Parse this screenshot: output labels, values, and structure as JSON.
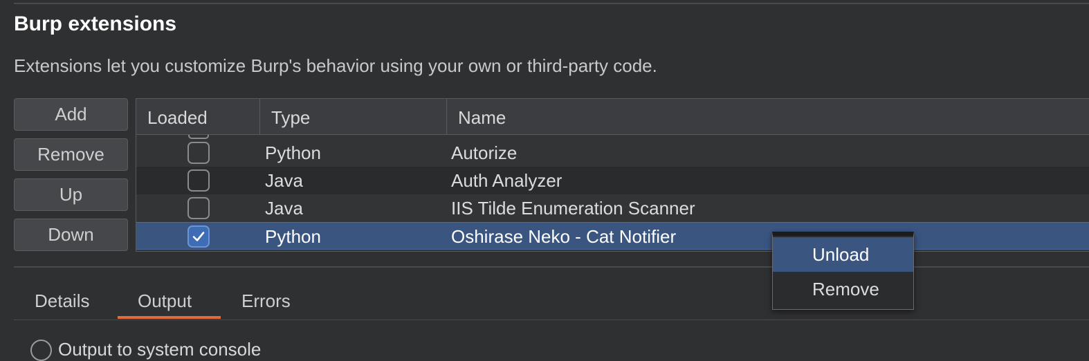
{
  "header": {
    "title": "Burp extensions",
    "description": "Extensions let you customize Burp's behavior using your own or third-party code."
  },
  "buttons": {
    "add": "Add",
    "remove": "Remove",
    "up": "Up",
    "down": "Down"
  },
  "table": {
    "columns": [
      "Loaded",
      "Type",
      "Name"
    ],
    "rows": [
      {
        "loaded": false,
        "type": "Python",
        "name": "Autorize"
      },
      {
        "loaded": false,
        "type": "Java",
        "name": "Auth Analyzer"
      },
      {
        "loaded": false,
        "type": "Java",
        "name": "IIS Tilde Enumeration Scanner"
      },
      {
        "loaded": true,
        "type": "Python",
        "name": "Oshirase Neko - Cat Notifier",
        "selected": true
      }
    ]
  },
  "context_menu": {
    "items": [
      "Unload",
      "Remove"
    ],
    "highlighted": "Unload"
  },
  "tabs": {
    "items": [
      "Details",
      "Output",
      "Errors"
    ],
    "active": "Output"
  },
  "output": {
    "option_label": "Output to system console"
  },
  "colors": {
    "background": "#2f3032",
    "selection": "#3a5580",
    "checkbox_checked": "#3e6db5",
    "tab_accent": "#e16c3a"
  }
}
